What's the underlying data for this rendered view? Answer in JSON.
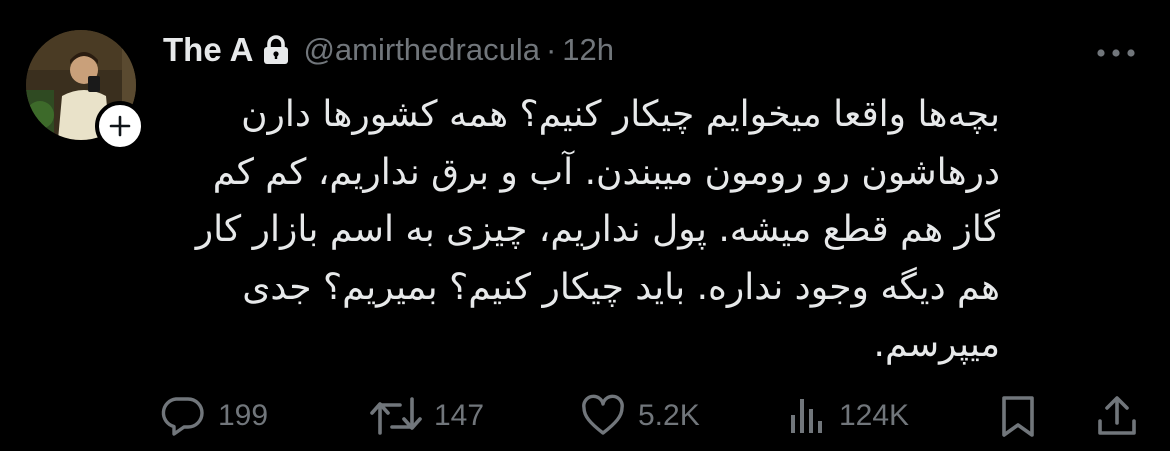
{
  "author": {
    "display_name": "The A",
    "handle": "@amirthedracula",
    "separator": "·",
    "time": "12h"
  },
  "icons": {
    "lock": "lock-icon",
    "more": "more-horizontal-icon",
    "follow": "plus-icon",
    "reply": "reply-bubble-icon",
    "retweet": "retweet-icon",
    "like": "heart-icon",
    "views": "analytics-bars-icon",
    "bookmark": "bookmark-icon",
    "share": "share-icon"
  },
  "tweet": {
    "text": "بچه‌ها واقعا میخوایم چیکار کنیم؟ همه کشورها دارن درهاشون رو رومون میبندن. آب و برق نداریم، کم کم گاز هم قطع میشه. پول نداریم، چیزی به اسم بازار کار هم دیگه وجود نداره. باید چیکار کنیم؟ بمیریم؟ جدی میپرسم."
  },
  "actions": {
    "replies": "199",
    "retweets": "147",
    "likes": "5.2K",
    "views": "124K"
  },
  "colors": {
    "background": "#000000",
    "primary_text": "#e7e9ea",
    "secondary_text": "#71767b"
  }
}
